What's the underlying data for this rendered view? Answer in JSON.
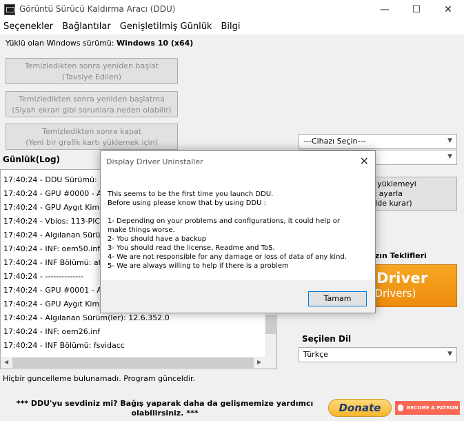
{
  "window": {
    "title": "Görüntü Sürücü Kaldırma Aracı (DDU)",
    "min_glyph": "—",
    "max_glyph": "☐",
    "close_glyph": "✕"
  },
  "menu": [
    "Seçenekler",
    "Bağlantılar",
    "Genişletilmiş Günlük",
    "Bilgi"
  ],
  "os": {
    "label": "Yüklü olan Windows sürümü:",
    "value": "Windows 10 (x64)"
  },
  "buttons": {
    "restart_line1": "Temizledikten sonra yeniden başlat",
    "restart_line2": "(Tavsiye Edilen)",
    "no_restart_line1": "Temizledikten sonra yeniden başlatma",
    "no_restart_line2": "(Siyah ekran gibi sorunlara neden olabilir)",
    "shutdown_line1": "Temizledikten sonra kapat",
    "shutdown_line2": "(Yeni bir grafik kartı yüklemek için)",
    "clean_line1": "ik Sürücü yüklemeyi",
    "clean_line2": "olarak ayarla",
    "clean_line3": "atik şekilde kurar)"
  },
  "log": {
    "label": "Günlük(Log)",
    "lines": [
      "17:40:24 - DDU Sürümü: 18",
      "17:40:24 - GPU #0000 - Al",
      "17:40:24 - GPU Aygıt Kimli",
      "17:40:24 - Vbios: 113-PICA",
      "17:40:24 - Algılanan Sürüm",
      "17:40:24 - INF: oem50.inf",
      "17:40:24 - INF Bölümü: ati2",
      "17:40:24 - --------------",
      "17:40:24 - GPU #0001 - Al",
      "17:40:24 - GPU Aygıt Kimli",
      "17:40:24 - Algılanan Sürüm(ler): 12.6.352.0",
      "17:40:24 - INF: oem26.inf",
      "17:40:24 - INF Bölümü: fsvidacc"
    ]
  },
  "status": "Hiçbir guncelleme bulunamadı. Program günceldir.",
  "device_select": {
    "value": "---Cihazı Seçin---"
  },
  "type_select": {
    "value": "---"
  },
  "offers": {
    "label": "ızın Teklifleri",
    "banner_title": "splay Driver",
    "banner_sub": "dware Drivers)"
  },
  "language": {
    "label": "Seçilen Dil",
    "value": "Türkçe"
  },
  "footer": {
    "text": "*** DDU'yu sevdiniz mi? Bağış yaparak daha da gelişmemize yardımcı olabilirsiniz. ***",
    "donate": "Donate",
    "patron": "BECOME A PATRON"
  },
  "dialog": {
    "title": "Display Driver Uninstaller",
    "close_glyph": "✕",
    "lines": [
      "This seems to be the first time you launch DDU.",
      "Before using please know that by using DDU :",
      "",
      "1- Depending on your problems and configurations, it could help or",
      "make things worse.",
      "2- You should have a backup",
      "3- You should read the license, Readme and ToS.",
      "4- We are not responsible for any damage or loss of data of any kind.",
      "5- We are always willing to help if there is a problem"
    ],
    "ok": "Tamam"
  },
  "colors": {
    "banner_orange": "#f39a1a",
    "donate_gold": "#f7b52c",
    "patron_red": "#f96854",
    "focus_blue": "#0078d7"
  }
}
